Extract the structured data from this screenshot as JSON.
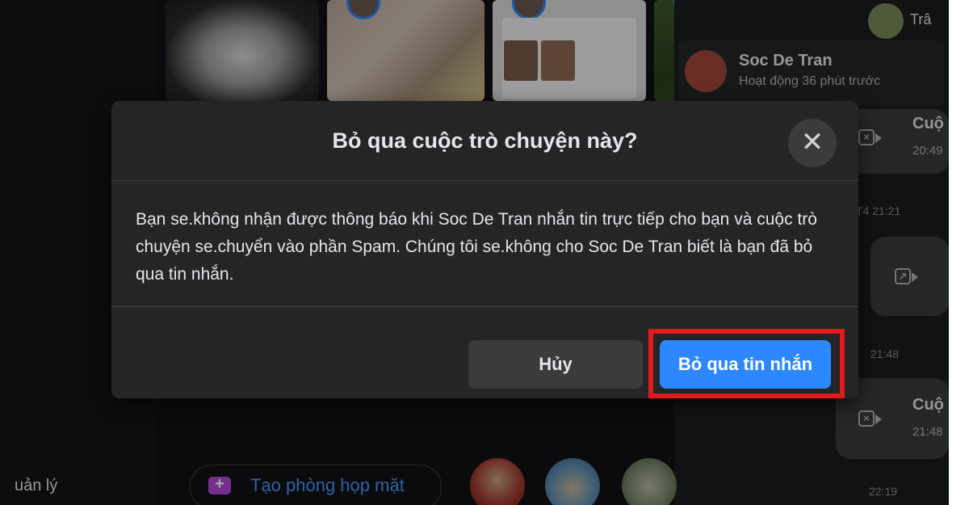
{
  "dialog": {
    "title": "Bỏ qua cuộc trò chuyện này?",
    "close_icon": "close-icon",
    "body": "Bạn se.không nhận được thông báo khi Soc De Tran nhắn tin trực tiếp cho bạn và cuộc trò chuyện se.chuyển vào phần Spam. Chúng tôi se.không cho Soc De Tran biết là bạn đã bỏ qua tin nhắn.",
    "cancel_label": "Hủy",
    "ignore_label": "Bỏ qua tin nhắn",
    "highlight_color": "#e11b1b",
    "primary_color": "#2d88ff"
  },
  "contact": {
    "top_name": "Trâ",
    "name": "Soc De Tran",
    "status": "Hoạt động 36 phút trước"
  },
  "chat": {
    "call_label": "Cuộ",
    "time_1": "20:49",
    "timestamp_1": "T4 21:21",
    "timestamp_2": "21:48",
    "time_2": "21:48",
    "timestamp_3": "22:19"
  },
  "bottom": {
    "left_text": "uản lý",
    "room_label": "Tạo phòng họp mặt",
    "room_icon": "video-plus-icon"
  }
}
